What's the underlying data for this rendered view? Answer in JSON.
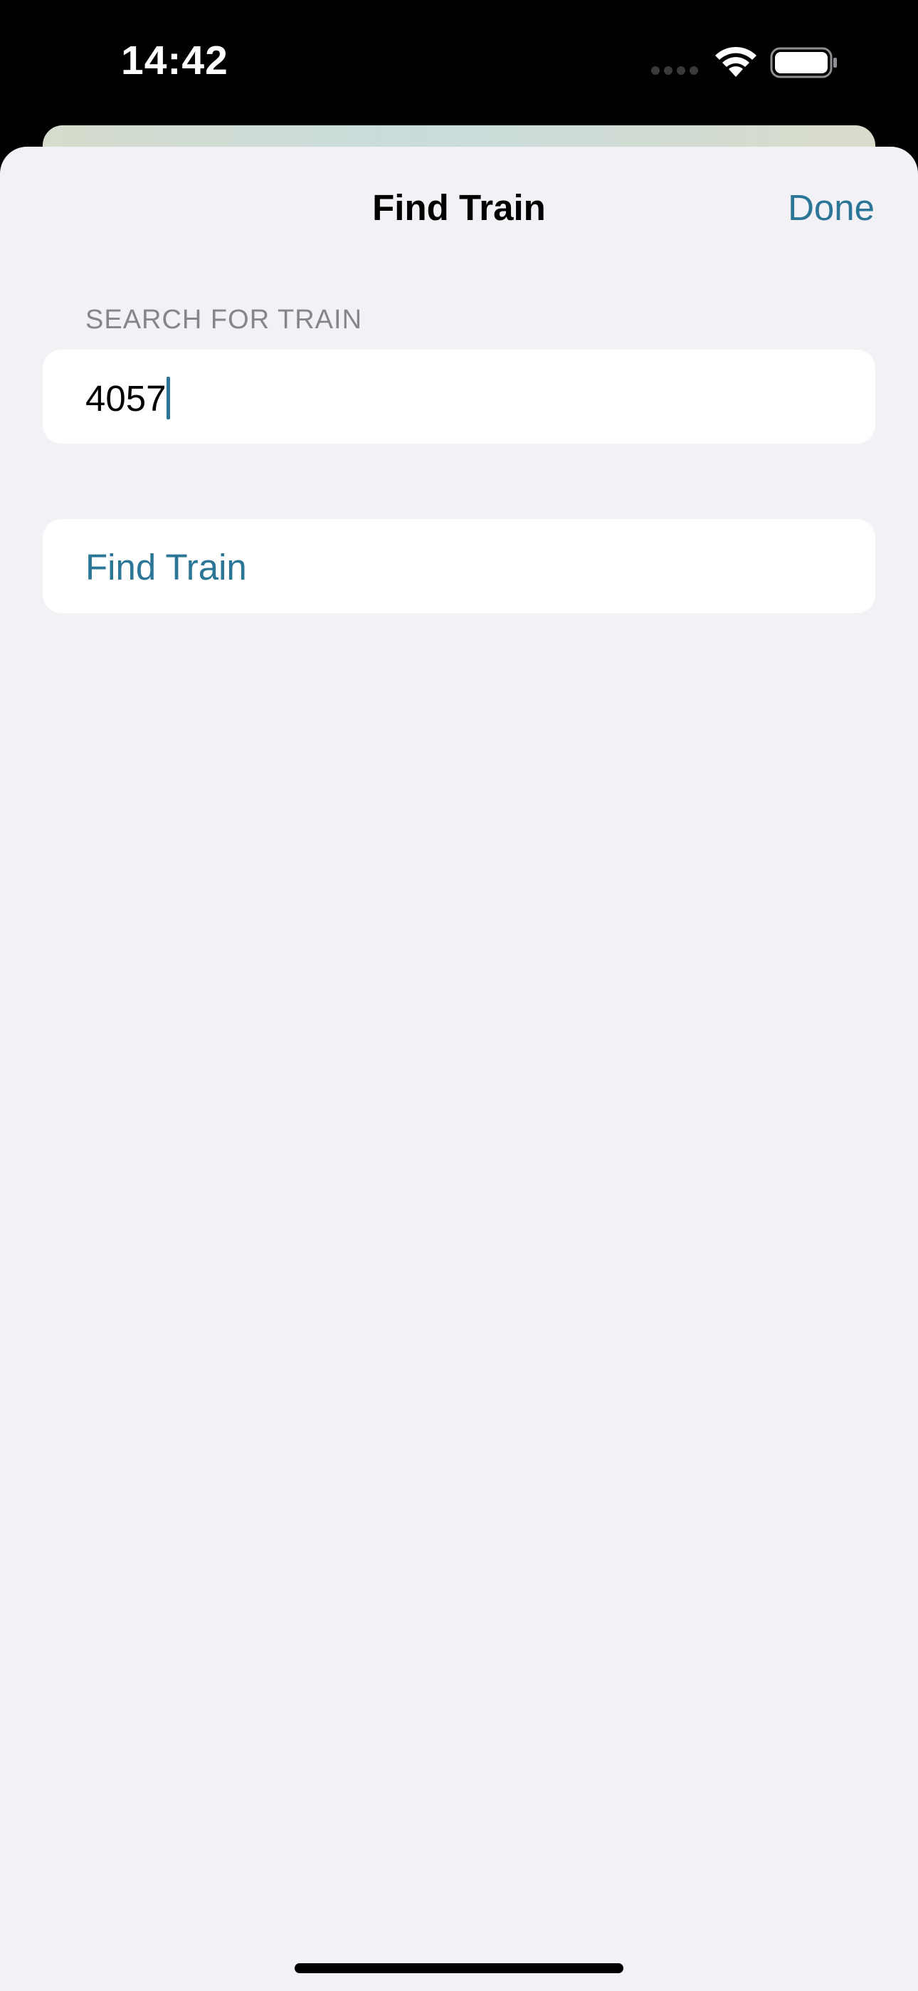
{
  "status_bar": {
    "time": "14:42",
    "signal_icon": "cellular-signal-icon",
    "wifi_icon": "wifi-icon",
    "battery_icon": "battery-icon"
  },
  "nav": {
    "title": "Find Train",
    "done_label": "Done"
  },
  "search": {
    "section_header": "SEARCH FOR TRAIN",
    "value": "4057"
  },
  "actions": {
    "find_label": "Find Train"
  },
  "colors": {
    "accent": "#2b7596",
    "background": "#f1f1f6",
    "cell": "#ffffff",
    "secondary_text": "#85858b"
  }
}
